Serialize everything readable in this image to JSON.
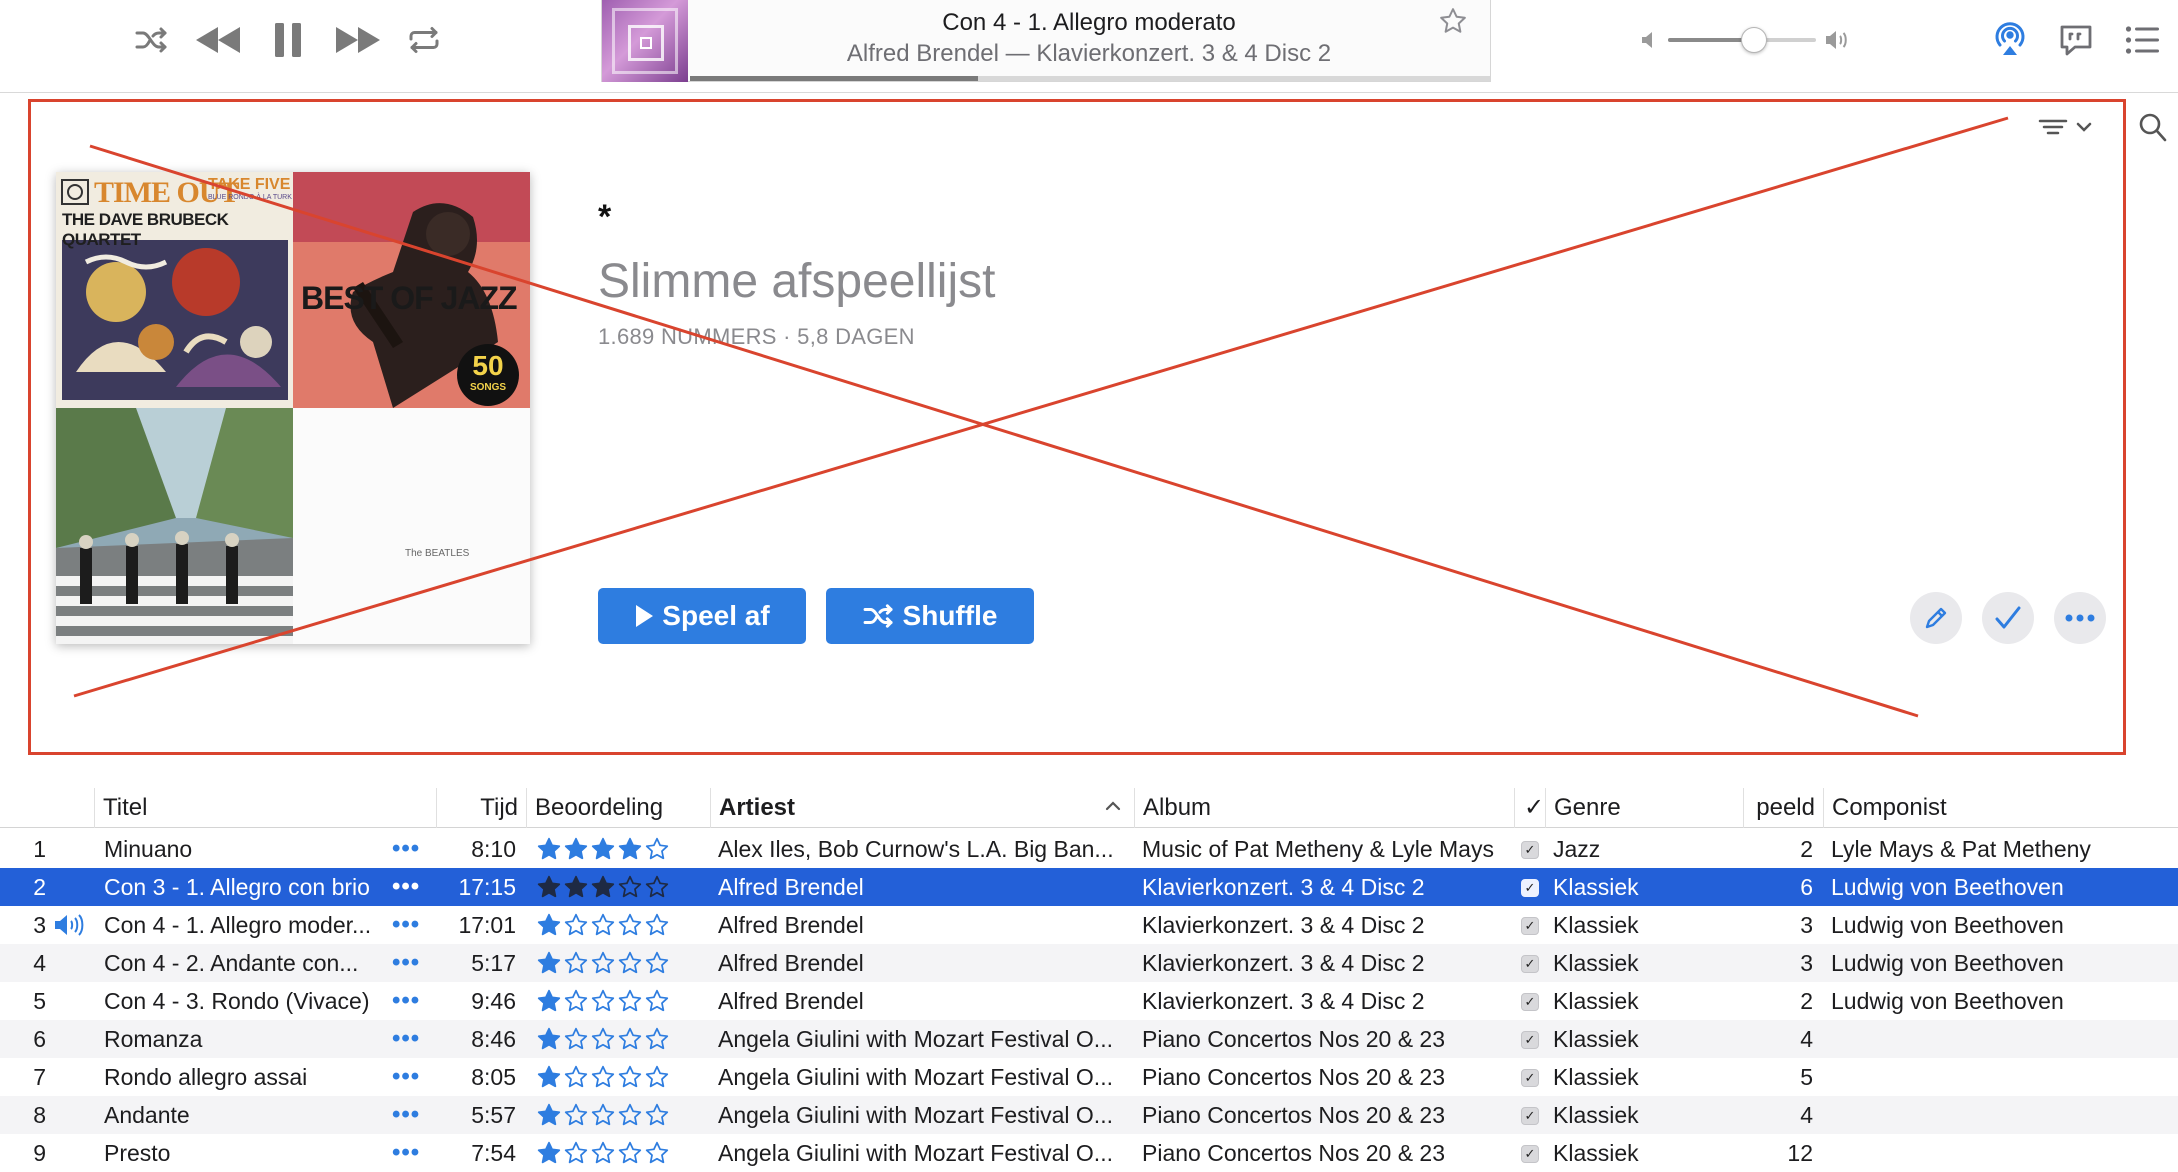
{
  "player": {
    "now_playing_title": "Con 4 - 1. Allegro moderato",
    "now_playing_subtitle": "Alfred Brendel — Klavierkonzert. 3 & 4 Disc 2",
    "progress": 0.36,
    "volume": 0.58
  },
  "playlist": {
    "symbol": "*",
    "title": "Slimme afspeellijst",
    "meta": "1.689 NUMMERS · 5,8 DAGEN",
    "play_label": "Speel af",
    "shuffle_label": "Shuffle",
    "artwork": {
      "tile1_line1": "TIME OUT",
      "tile1_line2": "TAKE FIVE",
      "tile1_line3": "BLUE RONDO À LA TURK",
      "tile1_line4": "THE DAVE BRUBECK QUARTET",
      "tile2_title": "BEST OF JAZZ",
      "tile2_badge_num": "50",
      "tile2_badge_txt": "SONGS",
      "tile4_text": "The BEATLES"
    }
  },
  "columns": {
    "title": "Titel",
    "time": "Tijd",
    "rating": "Beoordeling",
    "artist": "Artiest",
    "album": "Album",
    "check": "✓",
    "genre": "Genre",
    "plays": "peeld",
    "composer": "Componist"
  },
  "tracks": [
    {
      "num": "1",
      "title": "Minuano",
      "dots": "•••",
      "time": "8:10",
      "rating": 4,
      "artist": "Alex Iles, Bob Curnow's L.A. Big Ban...",
      "album": "Music of Pat Metheny & Lyle Mays",
      "check": "✓",
      "genre": "Jazz",
      "plays": "2",
      "composer": "Lyle Mays & Pat Metheny"
    },
    {
      "num": "2",
      "title": "Con 3 - 1. Allegro con brio",
      "dots": "•••",
      "time": "17:15",
      "rating": 3,
      "artist": "Alfred Brendel",
      "album": "Klavierkonzert. 3 & 4 Disc 2",
      "check": "✓",
      "genre": "Klassiek",
      "plays": "6",
      "composer": "Ludwig von Beethoven"
    },
    {
      "num": "3",
      "title": "Con 4 - 1. Allegro moder...",
      "dots": "•••",
      "time": "17:01",
      "rating": 1,
      "artist": "Alfred Brendel",
      "album": "Klavierkonzert. 3 & 4 Disc 2",
      "check": "✓",
      "genre": "Klassiek",
      "plays": "3",
      "composer": "Ludwig von Beethoven"
    },
    {
      "num": "4",
      "title": "Con 4 - 2. Andante con...",
      "dots": "•••",
      "time": "5:17",
      "rating": 1,
      "artist": "Alfred Brendel",
      "album": "Klavierkonzert. 3 & 4 Disc 2",
      "check": "✓",
      "genre": "Klassiek",
      "plays": "3",
      "composer": "Ludwig von Beethoven"
    },
    {
      "num": "5",
      "title": "Con 4 - 3. Rondo (Vivace)",
      "dots": "•••",
      "time": "9:46",
      "rating": 1,
      "artist": "Alfred Brendel",
      "album": "Klavierkonzert. 3 & 4 Disc 2",
      "check": "✓",
      "genre": "Klassiek",
      "plays": "2",
      "composer": "Ludwig von Beethoven"
    },
    {
      "num": "6",
      "title": "Romanza",
      "dots": "•••",
      "time": "8:46",
      "rating": 1,
      "artist": "Angela Giulini with Mozart Festival O...",
      "album": "Piano Concertos Nos 20 & 23",
      "check": "✓",
      "genre": "Klassiek",
      "plays": "4",
      "composer": ""
    },
    {
      "num": "7",
      "title": "Rondo allegro assai",
      "dots": "•••",
      "time": "8:05",
      "rating": 1,
      "artist": "Angela Giulini with Mozart Festival O...",
      "album": "Piano Concertos Nos 20 & 23",
      "check": "✓",
      "genre": "Klassiek",
      "plays": "5",
      "composer": ""
    },
    {
      "num": "8",
      "title": "Andante",
      "dots": "•••",
      "time": "5:57",
      "rating": 1,
      "artist": "Angela Giulini with Mozart Festival O...",
      "album": "Piano Concertos Nos 20 & 23",
      "check": "✓",
      "genre": "Klassiek",
      "plays": "4",
      "composer": ""
    },
    {
      "num": "9",
      "title": "Presto",
      "dots": "•••",
      "time": "7:54",
      "rating": 1,
      "artist": "Angela Giulini with Mozart Festival O...",
      "album": "Piano Concertos Nos 20 & 23",
      "check": "✓",
      "genre": "Klassiek",
      "plays": "12",
      "composer": ""
    }
  ],
  "state": {
    "selected_row": 1,
    "playing_row": 2
  },
  "colors": {
    "accent": "#2e7de0",
    "selection": "#2360d8",
    "annotation": "#d9442e"
  },
  "icons": [
    "shuffle-icon",
    "previous-icon",
    "pause-icon",
    "next-icon",
    "repeat-icon",
    "star-outline-icon",
    "volume-low-icon",
    "volume-high-icon",
    "airplay-icon",
    "lyrics-icon",
    "up-next-icon",
    "view-options-icon",
    "search-icon",
    "pencil-icon",
    "checkmark-icon",
    "more-icon",
    "speaker-icon"
  ]
}
